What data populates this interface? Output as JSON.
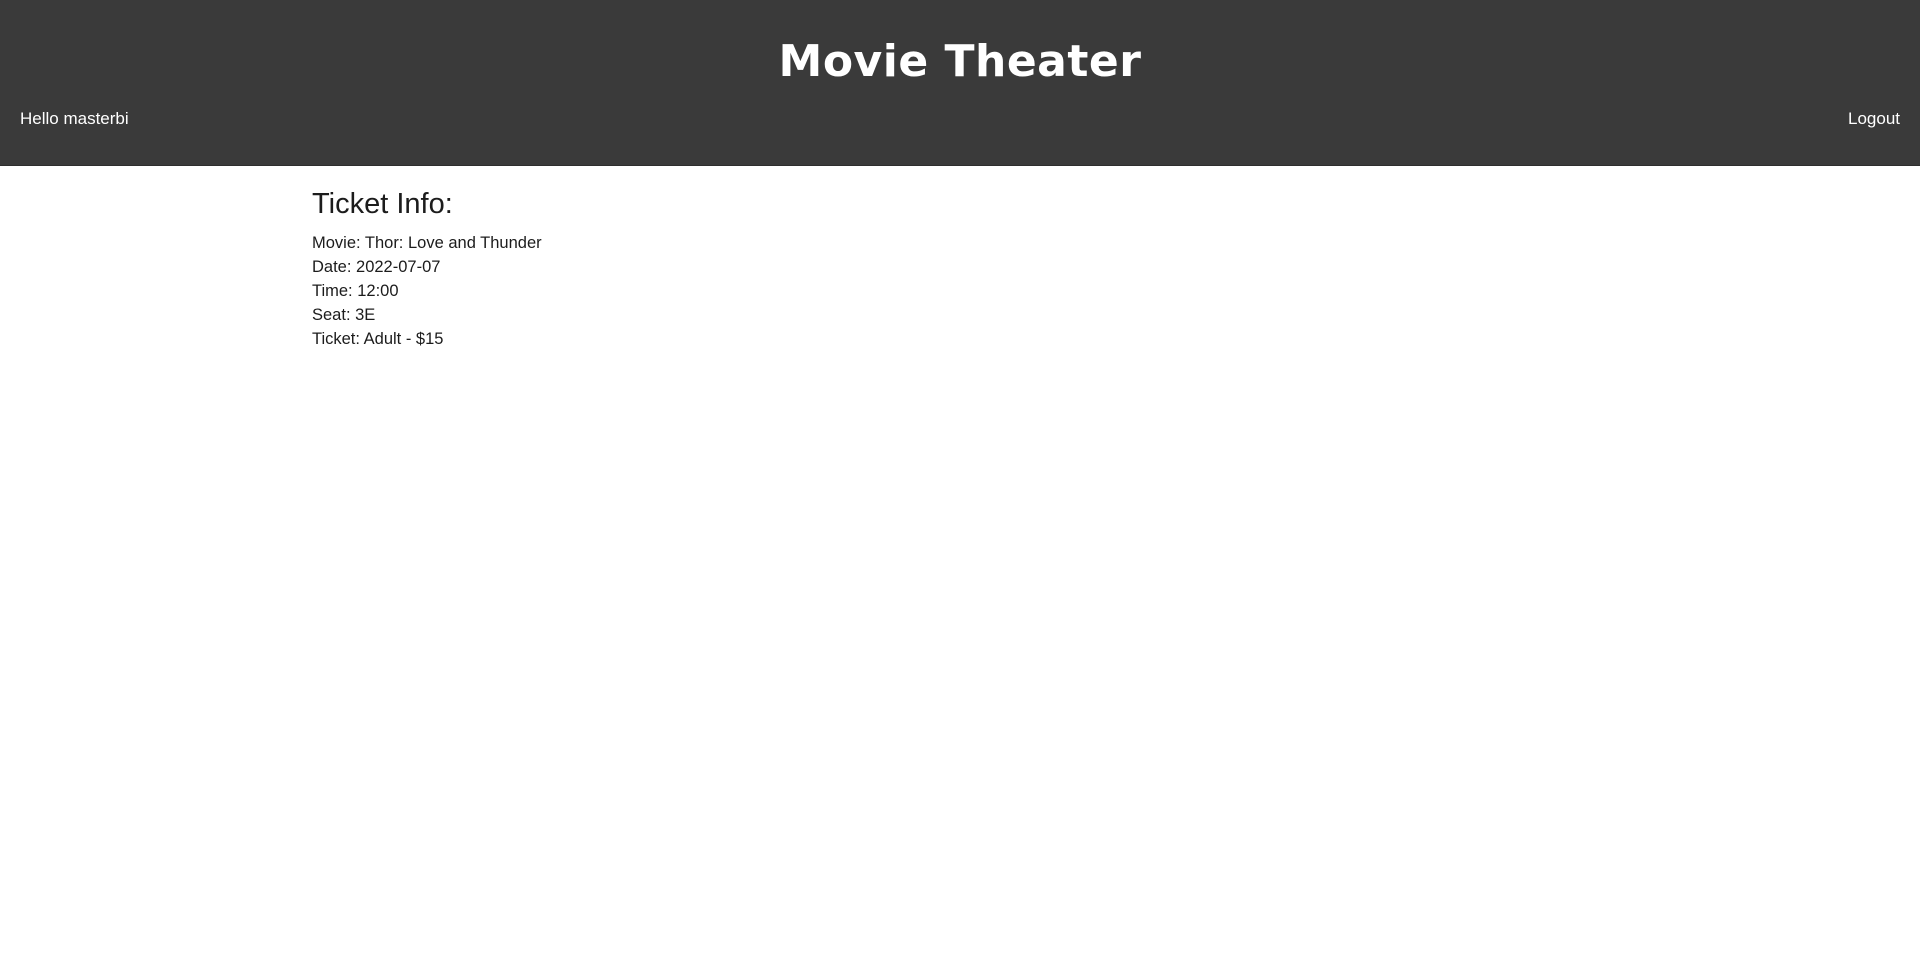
{
  "header": {
    "title": "Movie Theater",
    "greeting": "Hello masterbi",
    "logout_label": "Logout"
  },
  "ticket": {
    "heading": "Ticket Info:",
    "lines": [
      "Movie: Thor: Love and Thunder",
      "Date: 2022-07-07",
      "Time: 12:00",
      "Seat: 3E",
      "Ticket: Adult - $15"
    ]
  },
  "colors": {
    "header_bg": "#3a3a3a",
    "header_text": "#ffffff",
    "body_text": "#1c1c1c"
  }
}
